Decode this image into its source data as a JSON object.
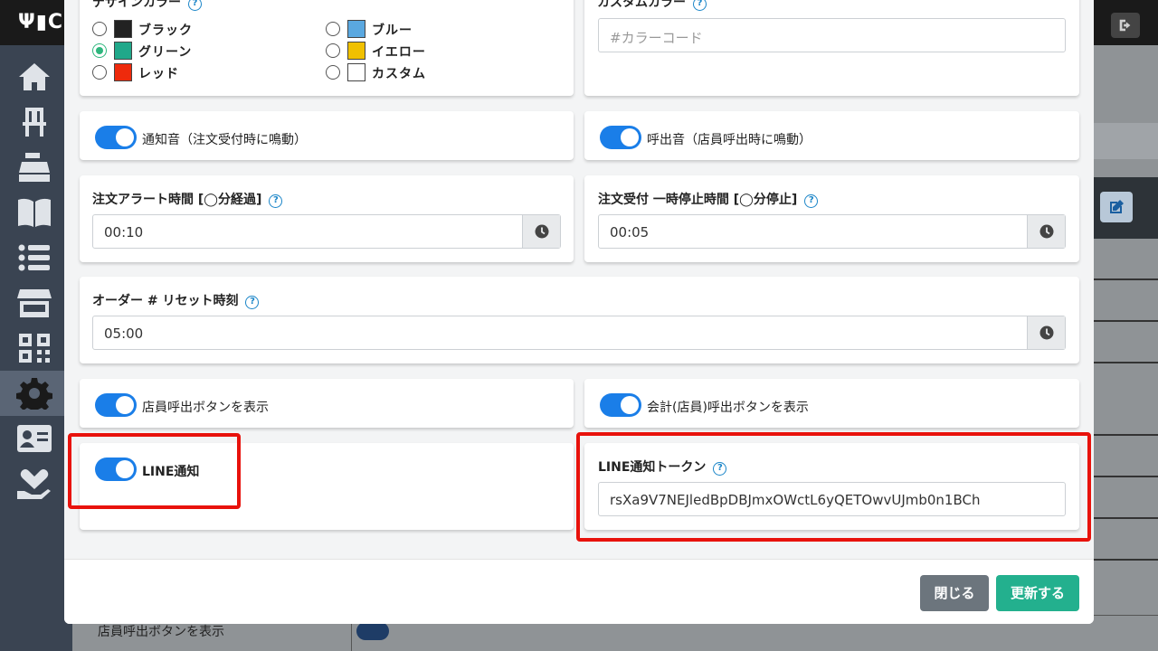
{
  "app": {
    "brand": "CU"
  },
  "colors": {
    "accent": "#1a7ee8",
    "highlight": "#e8120c",
    "update_button": "#23b08e",
    "close_button": "#6c757d"
  },
  "design_color": {
    "label": "デザインカラー",
    "options": [
      {
        "name": "ブラック",
        "swatch": "#222222",
        "selected": false
      },
      {
        "name": "グリーン",
        "swatch": "#20a88a",
        "selected": true
      },
      {
        "name": "レッド",
        "swatch": "#ee2a0c",
        "selected": false
      },
      {
        "name": "ブルー",
        "swatch": "#5aa8e0",
        "selected": false
      },
      {
        "name": "イエロー",
        "swatch": "#f0c000",
        "selected": false
      },
      {
        "name": "カスタム",
        "swatch": "#ffffff",
        "selected": false
      }
    ]
  },
  "custom_color": {
    "label": "カスタムカラー",
    "placeholder": "#カラーコード"
  },
  "toggles": {
    "notify_sound": {
      "label": "通知音（注文受付時に鳴動）",
      "on": true
    },
    "call_sound": {
      "label": "呼出音（店員呼出時に鳴動）",
      "on": true
    },
    "staff_call_button": {
      "label": "店員呼出ボタンを表示",
      "on": true
    },
    "checkout_call_button": {
      "label": "会計(店員)呼出ボタンを表示",
      "on": true
    },
    "line_notify": {
      "label": "LINE通知",
      "on": true
    }
  },
  "order_alert": {
    "label": "注文アラート時間 [◯分経過]",
    "value": "00:10"
  },
  "order_pause": {
    "label": "注文受付 一時停止時間 [◯分停止]",
    "value": "00:05"
  },
  "order_reset": {
    "label": "オーダー # リセット時刻",
    "value": "05:00"
  },
  "line_token": {
    "label": "LINE通知トークン",
    "value": "rsXa9V7NEJledBpDBJmxOWctL6yQETOwvUJmb0n1BCh"
  },
  "footer": {
    "close": "閉じる",
    "update": "更新する"
  },
  "background": {
    "row_label": "店員呼出ボタンを表示"
  },
  "icons": [
    "home-icon",
    "chair-icon",
    "register-icon",
    "book-icon",
    "list-icon",
    "store-icon",
    "qr-icon",
    "gear-icon",
    "id-card-icon",
    "hand-heart-icon",
    "logout-icon",
    "edit-icon",
    "clock-icon",
    "help-icon"
  ]
}
